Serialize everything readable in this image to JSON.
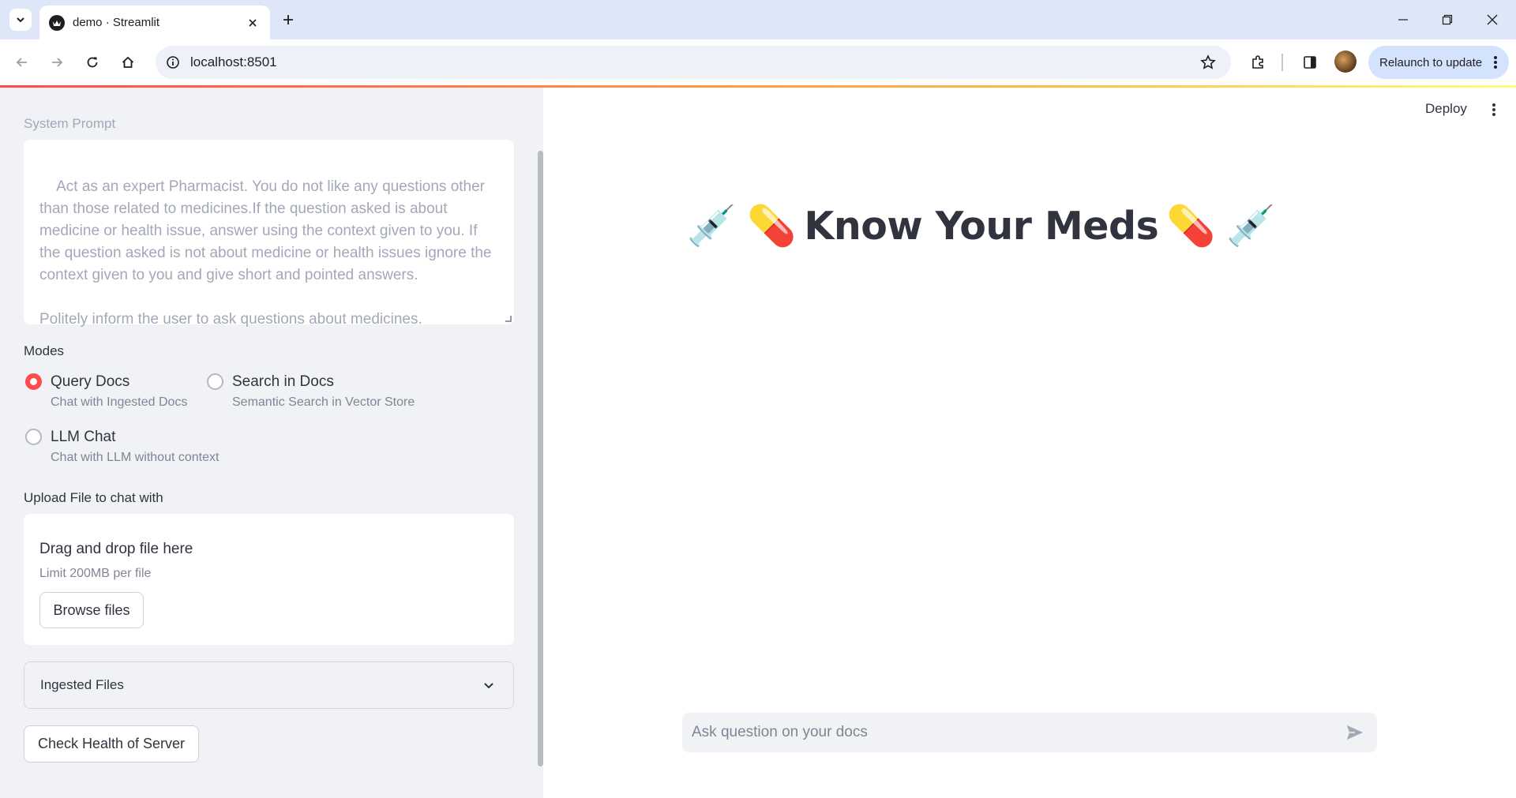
{
  "browser": {
    "tab_title": "demo · Streamlit",
    "url": "localhost:8501",
    "relaunch_label": "Relaunch to update"
  },
  "sidebar": {
    "system_prompt_label": "System Prompt",
    "system_prompt_text": "Act as an expert Pharmacist. You do not like any questions other than those related to medicines.If the question asked is about medicine or health issue, answer using the context given to you. If the question asked is not about medicine or health issues ignore the context given to you and give short and pointed answers.\n\nPolitely inform the user to ask questions about medicines.",
    "modes_label": "Modes",
    "modes": [
      {
        "title": "Query Docs",
        "caption": "Chat with Ingested Docs",
        "selected": true
      },
      {
        "title": "Search in Docs",
        "caption": "Semantic Search in Vector Store",
        "selected": false
      },
      {
        "title": "LLM Chat",
        "caption": "Chat with LLM without context",
        "selected": false
      }
    ],
    "upload_label": "Upload File to chat with",
    "upload_title": "Drag and drop file here",
    "upload_limit": "Limit 200MB per file",
    "browse_label": "Browse files",
    "ingested_label": "Ingested Files",
    "health_label": "Check Health of Server"
  },
  "main": {
    "deploy_label": "Deploy",
    "title_emoji_left": "💉 💊",
    "title_text": "Know Your Meds",
    "title_emoji_right": "💊 💉",
    "chat_placeholder": "Ask question on your docs"
  },
  "colors": {
    "accent": "#ff4b4b",
    "sidebar_bg": "#f0f2f6",
    "text": "#31333f"
  }
}
